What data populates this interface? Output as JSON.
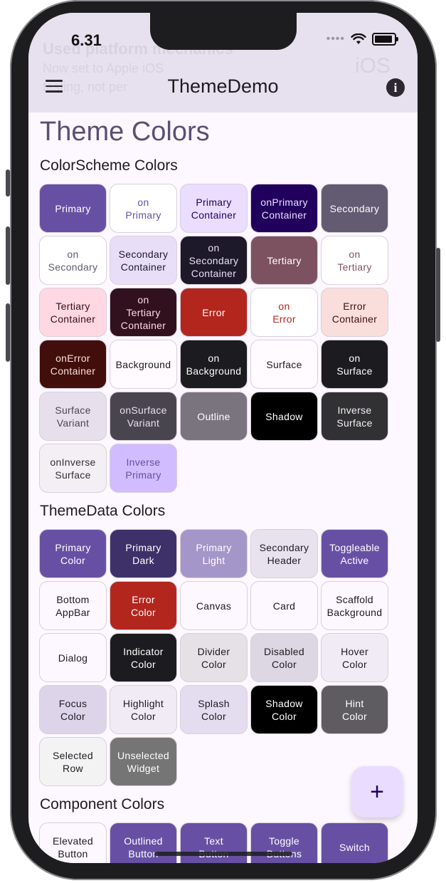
{
  "status": {
    "time": "6.31",
    "signal_dots": "••••"
  },
  "background_text": {
    "line1": "Used platform mechanics",
    "line2": "Now set to Apple iOS",
    "line3": "testing, not per",
    "platform": "iOS"
  },
  "appbar": {
    "title": "ThemeDemo",
    "menu_icon": "menu-icon",
    "info_icon": "info-icon",
    "info_glyph": "i"
  },
  "page_title": "Theme Colors",
  "sections": {
    "colorscheme": {
      "title": "ColorScheme Colors",
      "items": [
        {
          "label": "Primary",
          "bg": "#6750a4",
          "fg": "#ffffff"
        },
        {
          "label": "on\nPrimary",
          "bg": "#ffffff",
          "fg": "#6750a4"
        },
        {
          "label": "Primary\nContainer",
          "bg": "#eaddff",
          "fg": "#21005d"
        },
        {
          "label": "onPrimary\nContainer",
          "bg": "#21005d",
          "fg": "#eaddff"
        },
        {
          "label": "Secondary",
          "bg": "#625b71",
          "fg": "#ffffff"
        },
        {
          "label": "on\nSecondary",
          "bg": "#ffffff",
          "fg": "#625b71"
        },
        {
          "label": "Secondary\nContainer",
          "bg": "#e8def8",
          "fg": "#1d192b"
        },
        {
          "label": "on\nSecondary\nContainer",
          "bg": "#1d192b",
          "fg": "#e8def8"
        },
        {
          "label": "Tertiary",
          "bg": "#7d5260",
          "fg": "#ffffff"
        },
        {
          "label": "on\nTertiary",
          "bg": "#ffffff",
          "fg": "#7d5260"
        },
        {
          "label": "Tertiary\nContainer",
          "bg": "#ffd8e4",
          "fg": "#31111d"
        },
        {
          "label": "on\nTertiary\nContainer",
          "bg": "#31111d",
          "fg": "#ffd8e4"
        },
        {
          "label": "Error",
          "bg": "#b3261e",
          "fg": "#ffffff"
        },
        {
          "label": "on\nError",
          "bg": "#ffffff",
          "fg": "#b3261e"
        },
        {
          "label": "Error\nContainer",
          "bg": "#f9dedc",
          "fg": "#410e0b"
        },
        {
          "label": "onError\nContainer",
          "bg": "#410e0b",
          "fg": "#f9dedc"
        },
        {
          "label": "Background",
          "bg": "#fffbfe",
          "fg": "#1c1b1f"
        },
        {
          "label": "on\nBackground",
          "bg": "#1c1b1f",
          "fg": "#fffbfe"
        },
        {
          "label": "Surface",
          "bg": "#fffbfe",
          "fg": "#1c1b1f"
        },
        {
          "label": "on\nSurface",
          "bg": "#1c1b1f",
          "fg": "#fffbfe"
        },
        {
          "label": "Surface\nVariant",
          "bg": "#e7e0ec",
          "fg": "#49454f"
        },
        {
          "label": "onSurface\nVariant",
          "bg": "#49454f",
          "fg": "#e7e0ec"
        },
        {
          "label": "Outline",
          "bg": "#79747e",
          "fg": "#ffffff"
        },
        {
          "label": "Shadow",
          "bg": "#000000",
          "fg": "#ffffff"
        },
        {
          "label": "Inverse\nSurface",
          "bg": "#313033",
          "fg": "#f4eff4"
        },
        {
          "label": "onInverse\nSurface",
          "bg": "#f4eff4",
          "fg": "#313033"
        },
        {
          "label": "Inverse\nPrimary",
          "bg": "#d0bcff",
          "fg": "#6750a4"
        }
      ]
    },
    "themedata": {
      "title": "ThemeData Colors",
      "items": [
        {
          "label": "Primary\nColor",
          "bg": "#6750a4",
          "fg": "#ffffff"
        },
        {
          "label": "Primary\nDark",
          "bg": "#3e3068",
          "fg": "#ffffff"
        },
        {
          "label": "Primary\nLight",
          "bg": "#a496c8",
          "fg": "#ffffff"
        },
        {
          "label": "Secondary\nHeader",
          "bg": "#e8e2ee",
          "fg": "#1d1b20"
        },
        {
          "label": "Toggleable\nActive",
          "bg": "#6750a4",
          "fg": "#ffffff"
        },
        {
          "label": "Bottom\nAppBar",
          "bg": "#fdf7ff",
          "fg": "#1d1b20"
        },
        {
          "label": "Error\nColor",
          "bg": "#b3261e",
          "fg": "#ffffff"
        },
        {
          "label": "Canvas",
          "bg": "#fdf7ff",
          "fg": "#1d1b20"
        },
        {
          "label": "Card",
          "bg": "#fdf7ff",
          "fg": "#1d1b20"
        },
        {
          "label": "Scaffold\nBackground",
          "bg": "#fdf7ff",
          "fg": "#1d1b20"
        },
        {
          "label": "Dialog",
          "bg": "#fdf7ff",
          "fg": "#1d1b20"
        },
        {
          "label": "Indicator\nColor",
          "bg": "#1c1b1f",
          "fg": "#ffffff"
        },
        {
          "label": "Divider\nColor",
          "bg": "#e6e1e6",
          "fg": "#1d1b20"
        },
        {
          "label": "Disabled\nColor",
          "bg": "#ddd7e3",
          "fg": "#1d1b20"
        },
        {
          "label": "Hover\nColor",
          "bg": "#f1ebf5",
          "fg": "#1d1b20"
        },
        {
          "label": "Focus\nColor",
          "bg": "#ddd4ea",
          "fg": "#1d1b20"
        },
        {
          "label": "Highlight\nColor",
          "bg": "#f1ebf5",
          "fg": "#1d1b20"
        },
        {
          "label": "Splash\nColor",
          "bg": "#e4ddf0",
          "fg": "#1d1b20"
        },
        {
          "label": "Shadow\nColor",
          "bg": "#000000",
          "fg": "#ffffff"
        },
        {
          "label": "Hint\nColor",
          "bg": "#5f5c61",
          "fg": "#ffffff"
        },
        {
          "label": "Selected\nRow",
          "bg": "#f3f3f3",
          "fg": "#1d1b20"
        },
        {
          "label": "Unselected\nWidget",
          "bg": "#757575",
          "fg": "#ffffff"
        }
      ]
    },
    "component": {
      "title": "Component Colors",
      "items": [
        {
          "label": "Elevated\nButton",
          "bg": "#fdf7ff",
          "fg": "#1d1b20"
        },
        {
          "label": "Outlined\nButton",
          "bg": "#6750a4",
          "fg": "#ffffff"
        },
        {
          "label": "Text\nButton",
          "bg": "#6750a4",
          "fg": "#ffffff"
        },
        {
          "label": "Toggle\nButtons",
          "bg": "#6750a4",
          "fg": "#ffffff"
        },
        {
          "label": "Switch",
          "bg": "#6750a4",
          "fg": "#ffffff"
        }
      ]
    }
  },
  "fab": {
    "glyph": "+",
    "icon": "add-icon"
  },
  "colors": {
    "appbar": "#e7e0ef",
    "page_bg": "#fdf7ff",
    "title": "#5b4f75",
    "fab": "#eadcff"
  }
}
